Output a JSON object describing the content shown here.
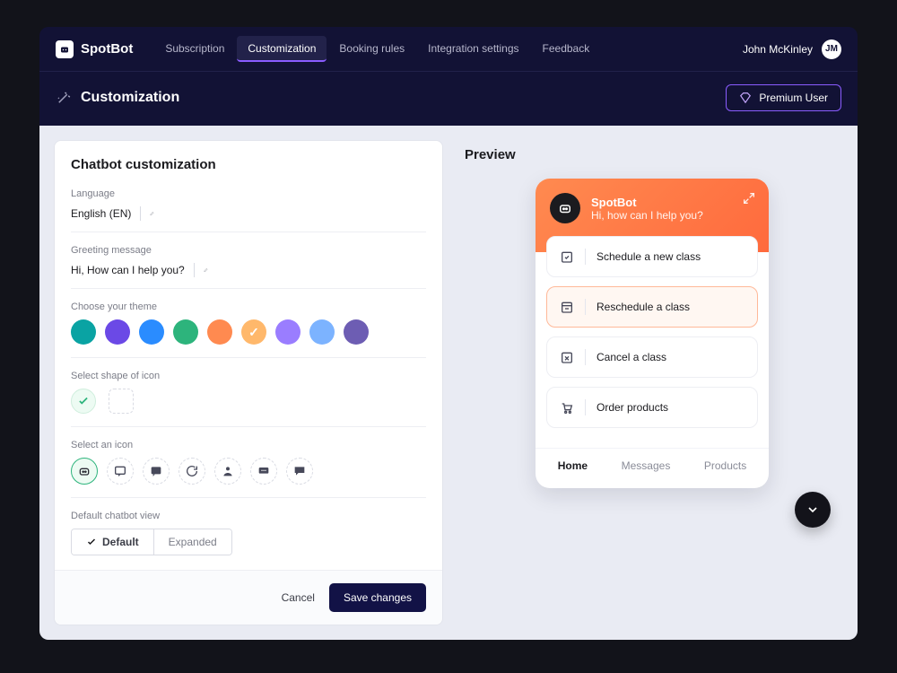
{
  "brand": {
    "name": "SpotBot"
  },
  "nav": {
    "items": [
      "Subscription",
      "Customization",
      "Booking rules",
      "Integration settings",
      "Feedback"
    ],
    "active_index": 1
  },
  "user": {
    "name": "John McKinley",
    "initials": "JM"
  },
  "page": {
    "title": "Customization",
    "premium_label": "Premium User"
  },
  "panel": {
    "title": "Chatbot customization",
    "language_label": "Language",
    "language_value": "English (EN)",
    "greeting_label": "Greeting message",
    "greeting_value": "Hi, How can I help you?",
    "theme_label": "Choose your theme",
    "theme_colors": [
      "#0aa3a3",
      "#6b49e6",
      "#2a8cff",
      "#2db47c",
      "#ff8a50",
      "#ffb86b",
      "#9a7dff",
      "#7cb3ff",
      "#6d5db3"
    ],
    "theme_selected_index": 5,
    "shape_label": "Select shape of icon",
    "icon_label": "Select an icon",
    "icon_selected_index": 0,
    "view_label": "Default chatbot view",
    "view_options": [
      "Default",
      "Expanded"
    ],
    "view_selected_index": 0,
    "cancel_label": "Cancel",
    "save_label": "Save changes"
  },
  "preview": {
    "title": "Preview",
    "bot_name": "SpotBot",
    "bot_greeting": "Hi, how can I help you?",
    "actions": [
      "Schedule a new class",
      "Reschedule a class",
      "Cancel a class",
      "Order products"
    ],
    "action_highlight_index": 1,
    "tabs": [
      "Home",
      "Messages",
      "Products"
    ],
    "tab_active_index": 0
  }
}
